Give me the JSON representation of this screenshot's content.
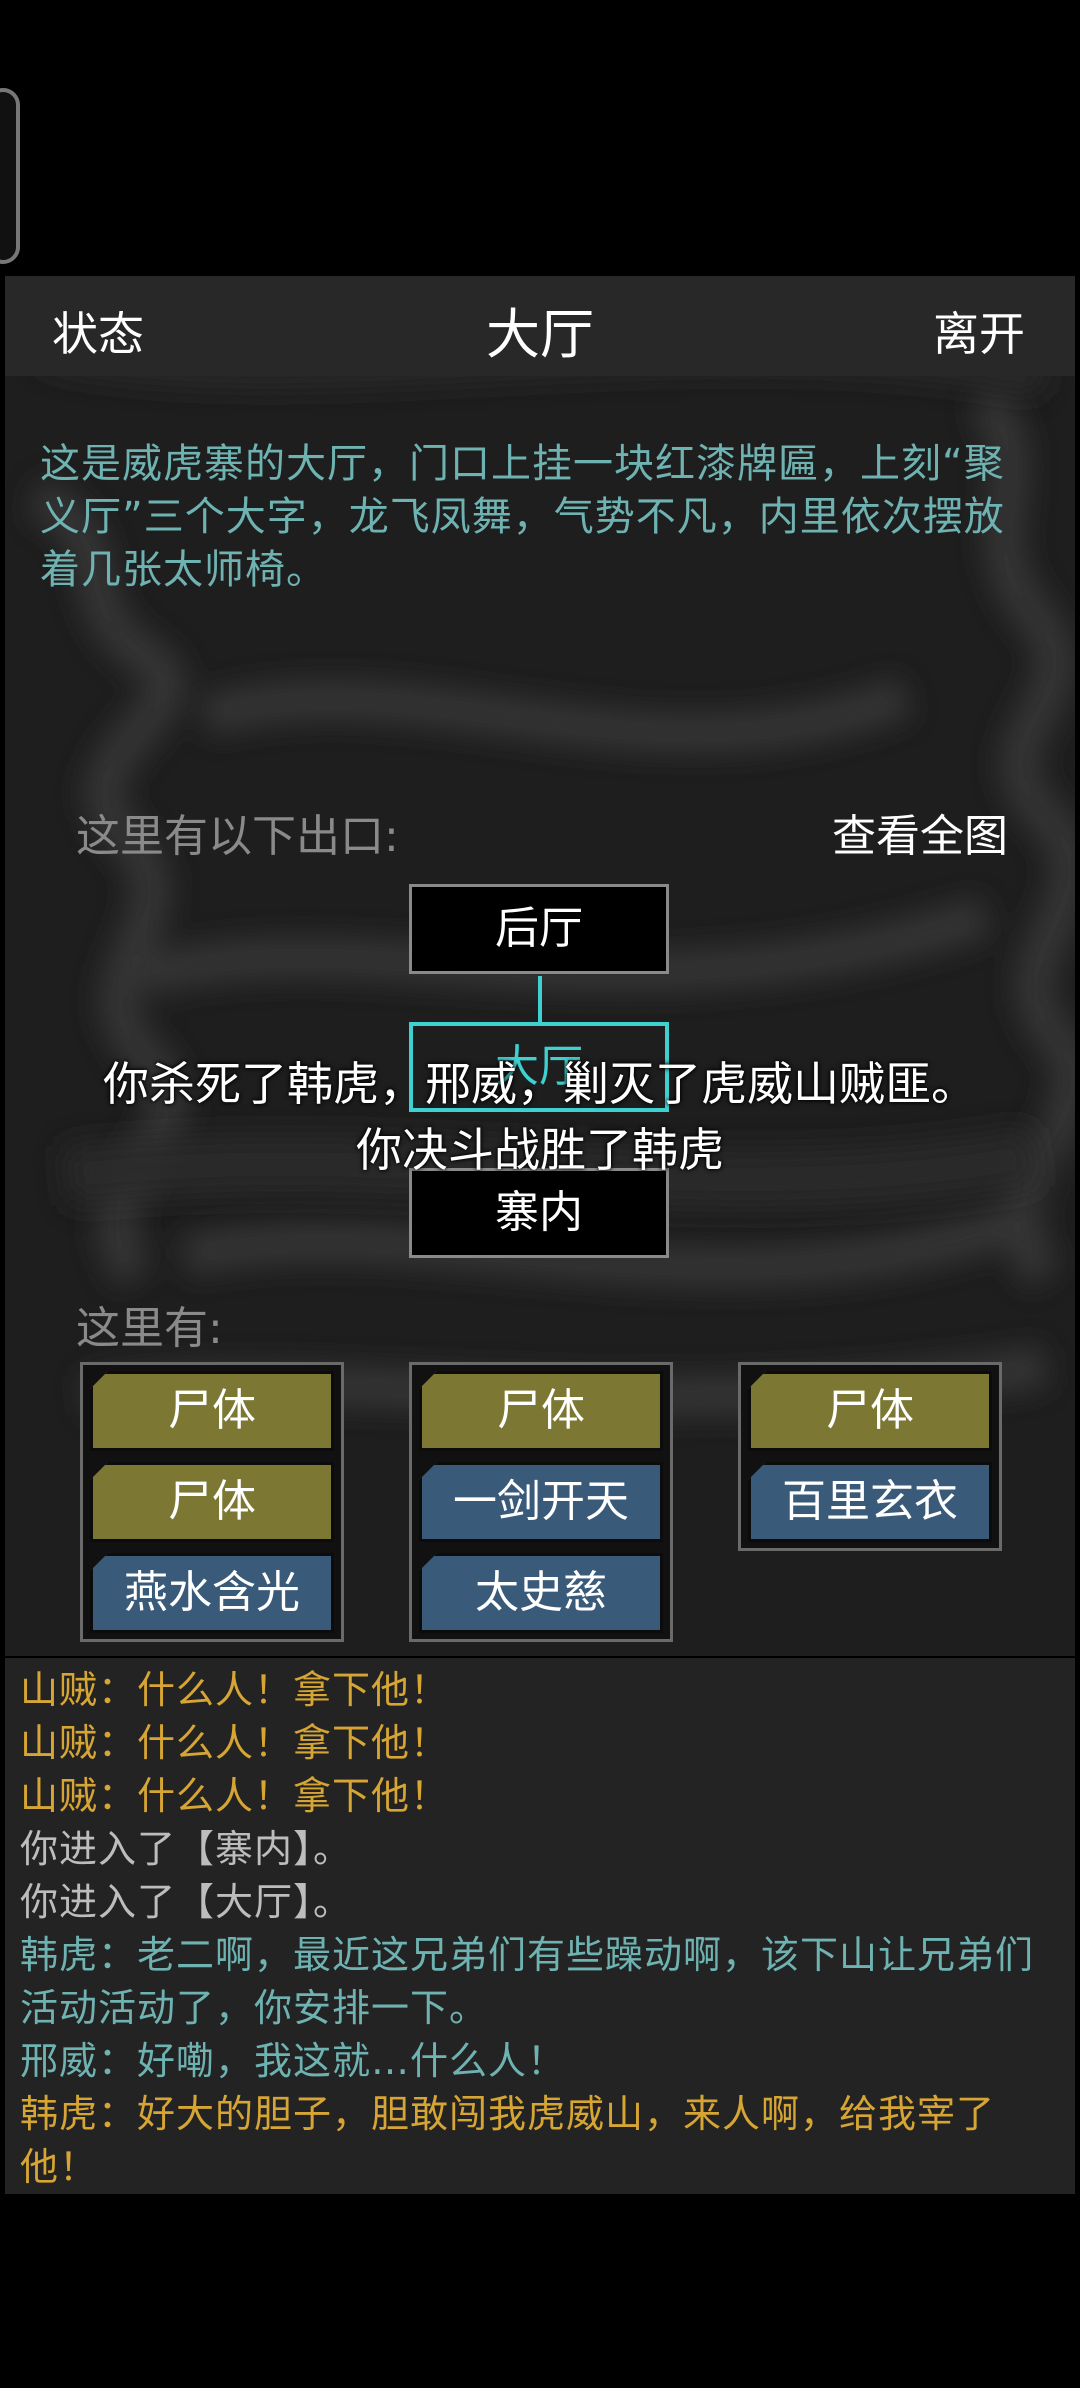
{
  "header": {
    "left": "状态",
    "title": "大厅",
    "right": "离开"
  },
  "description": "这是威虎寨的大厅，门口上挂一块红漆牌匾，上刻“聚义厅”三个大字，龙飞凤舞，气势不凡，内里依次摆放着几张太师椅。",
  "exits": {
    "label": "这里有以下出口:",
    "view_map": "查看全图",
    "north": "后厅",
    "current": "大厅",
    "south": "寨内"
  },
  "overlay": {
    "line1": "你杀死了韩虎，邢威，剿灭了虎威山贼匪。",
    "line2": "你决斗战胜了韩虎"
  },
  "here": {
    "label": "这里有:",
    "columns": [
      [
        {
          "name": "尸体",
          "kind": "corpse"
        },
        {
          "name": "尸体",
          "kind": "corpse"
        },
        {
          "name": "燕水含光",
          "kind": "npc"
        }
      ],
      [
        {
          "name": "尸体",
          "kind": "corpse"
        },
        {
          "name": "一剑开天",
          "kind": "npc"
        },
        {
          "name": "太史慈",
          "kind": "npc"
        }
      ],
      [
        {
          "name": "尸体",
          "kind": "corpse"
        },
        {
          "name": "百里玄衣",
          "kind": "npc"
        }
      ]
    ]
  },
  "log": [
    {
      "text": "山贼：什么人！拿下他！",
      "color": "#d6a534"
    },
    {
      "text": "山贼：什么人！拿下他！",
      "color": "#d6a534"
    },
    {
      "text": "山贼：什么人！拿下他！",
      "color": "#d6a534"
    },
    {
      "text": "你进入了【寨内】。",
      "color": "#bdbdbd"
    },
    {
      "text": "你进入了【大厅】。",
      "color": "#bdbdbd"
    },
    {
      "text": "韩虎：老二啊，最近这兄弟们有些躁动啊，该下山让兄弟们活动活动了，你安排一下。",
      "color": "#6fb2b2"
    },
    {
      "text": "邢威：好嘞，我这就…什么人！",
      "color": "#6fb2b2"
    },
    {
      "text": "韩虎：好大的胆子，胆敢闯我虎威山，来人啊，给我宰了他！",
      "color": "#d6a534"
    }
  ]
}
